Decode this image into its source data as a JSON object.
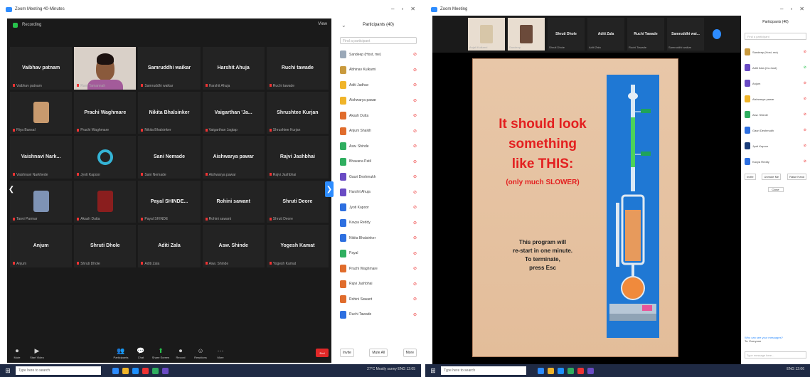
{
  "left": {
    "window_title": "Zoom Meeting 40-Minutes",
    "meeting_top": {
      "recording": "Recording",
      "view_label": "View"
    },
    "tiles": [
      {
        "name": "Vaibhav patnam",
        "sub": "Vaibhav patnam",
        "type": "name"
      },
      {
        "name": "",
        "sub": "Rani Tamannah",
        "type": "video"
      },
      {
        "name": "Samruddhi waikar",
        "sub": "Samruddhi waikar",
        "type": "name"
      },
      {
        "name": "Harshit Ahuja",
        "sub": "Harshit Ahuja",
        "type": "name"
      },
      {
        "name": "Ruchi tawade",
        "sub": "Ruchi tawade",
        "type": "name"
      },
      {
        "name": "",
        "sub": "Riya Bansal",
        "type": "photo",
        "color": "#c89a6e"
      },
      {
        "name": "Prachi Waghmare",
        "sub": "Prachi Waghmare",
        "type": "name"
      },
      {
        "name": "Nikita Bhalsinker",
        "sub": "Nikita Bhalsinker",
        "type": "name"
      },
      {
        "name": "Vaigarthan 'Ja...",
        "sub": "Vaigarthan Jagtap",
        "type": "name"
      },
      {
        "name": "Shrushtee Kurjan",
        "sub": "Shrushtee Kurjan",
        "type": "name"
      },
      {
        "name": "Vaishnavi Nark...",
        "sub": "Vaishnavi Narkhede",
        "type": "name"
      },
      {
        "name": "",
        "sub": "Jyoti Kapoor",
        "type": "ring"
      },
      {
        "name": "Sani Nemade",
        "sub": "Sani Nemade",
        "type": "name"
      },
      {
        "name": "Aishwarya pawar",
        "sub": "Aishwarya pawar",
        "type": "name"
      },
      {
        "name": "Rajvi Jashbhai",
        "sub": "Rajvi Jashbhai",
        "type": "name"
      },
      {
        "name": "",
        "sub": "Tanvi Parmar",
        "type": "photo",
        "color": "#7e93b5"
      },
      {
        "name": "",
        "sub": "Akash Dutta",
        "type": "photo",
        "color": "#8a1e1e"
      },
      {
        "name": "Payal SHINDE...",
        "sub": "Payal SHINDE",
        "type": "name"
      },
      {
        "name": "Rohini sawant",
        "sub": "Rohini sawant",
        "type": "name"
      },
      {
        "name": "Shruti Deore",
        "sub": "Shruti Deore",
        "type": "name"
      },
      {
        "name": "Anjum",
        "sub": "Anjum",
        "type": "name"
      },
      {
        "name": "Shruti Dhole",
        "sub": "Shruti Dhole",
        "type": "name"
      },
      {
        "name": "Aditi Zala",
        "sub": "Aditi Zala",
        "type": "name"
      },
      {
        "name": "Asw. Shinde",
        "sub": "Asw. Shinde",
        "type": "name"
      },
      {
        "name": "Yogesh Kamat",
        "sub": "Yogesh Kamat",
        "type": "name"
      }
    ],
    "toolbar": [
      {
        "icon": "⏺",
        "label": "Mute"
      },
      {
        "icon": "▶",
        "label": "Start Video"
      },
      {
        "icon": "👥",
        "label": "Participants"
      },
      {
        "icon": "💬",
        "label": "Chat"
      },
      {
        "icon": "⬆",
        "label": "Share Screen"
      },
      {
        "icon": "⏺",
        "label": "Record"
      },
      {
        "icon": "☺",
        "label": "Reactions"
      },
      {
        "icon": "⋯",
        "label": "More"
      }
    ],
    "end_label": "End",
    "participants": {
      "title": "Participants (40)",
      "search": "Find a participant",
      "rows": [
        {
          "name": "Sandeep (Host, me)",
          "color": "#9aa8b8"
        },
        {
          "name": "Abhinav Kulkarni",
          "color": "#c99a3e"
        },
        {
          "name": "Aditi Jadhav",
          "color": "#f0b429"
        },
        {
          "name": "Aishwarya pawar",
          "color": "#f0b429"
        },
        {
          "name": "Akash Dutta",
          "color": "#e06c2c"
        },
        {
          "name": "Anjum Shaikh",
          "color": "#e06c2c"
        },
        {
          "name": "Asw. Shinde",
          "color": "#2fae5f"
        },
        {
          "name": "Bhavana Patil",
          "color": "#2fae5f"
        },
        {
          "name": "Gauri Deshmukh",
          "color": "#6a4bc4"
        },
        {
          "name": "Harshit Ahuja",
          "color": "#6a4bc4"
        },
        {
          "name": "Jyoti Kapoor",
          "color": "#2d6fe0"
        },
        {
          "name": "Kavya Reddy",
          "color": "#2d6fe0"
        },
        {
          "name": "Nikita Bhalsinker",
          "color": "#2d6fe0"
        },
        {
          "name": "Payal",
          "color": "#2fae5f"
        },
        {
          "name": "Prachi Waghmare",
          "color": "#e06c2c"
        },
        {
          "name": "Rajvi Jashbhai",
          "color": "#e06c2c"
        },
        {
          "name": "Rohini Sawant",
          "color": "#e06c2c"
        },
        {
          "name": "Ruchi Tawade",
          "color": "#2d6fe0"
        }
      ],
      "foot": [
        "Invite",
        "Mute All",
        "More"
      ]
    },
    "taskbar": {
      "search": "Type here to search",
      "tray": "27°C  Mostly sunny   ENG  12:05"
    }
  },
  "right": {
    "window_title": "Zoom Meeting",
    "strip": [
      {
        "name": "",
        "sub": "Anjali Kulkarni",
        "type": "photo",
        "color": "#d7c6a8"
      },
      {
        "name": "",
        "sub": "Sandeep",
        "type": "photo",
        "color": "#6b4a3a"
      },
      {
        "name": "Shruti Dhole",
        "sub": "Shruti Dhole",
        "type": "name"
      },
      {
        "name": "Aditi Zala",
        "sub": "Aditi Zala",
        "type": "name"
      },
      {
        "name": "Ruchi Tawade",
        "sub": "Ruchi Tawade",
        "type": "name"
      },
      {
        "name": "Samruddhi wai...",
        "sub": "Samruddhi waikar",
        "type": "name"
      }
    ],
    "slide": {
      "line1": "It should look",
      "line2": "something",
      "line3": "like THIS:",
      "line4": "(only much SLOWER)",
      "note1": "This program will",
      "note2": "re-start in one minute.",
      "note3": "To terminate,",
      "note4": "press Esc"
    },
    "participants": {
      "title": "Participants (40)",
      "search": "Find a participant",
      "rows": [
        {
          "name": "Sandeep (Host, me)",
          "color": "#c99a3e"
        },
        {
          "name": "Aditi Zala (Co-host)",
          "color": "#6a4bc4"
        },
        {
          "name": "Anjum",
          "color": "#6a4bc4"
        },
        {
          "name": "Aishwarya pawar",
          "color": "#f0b429"
        },
        {
          "name": "Asw. Shinde",
          "color": "#2fae5f"
        },
        {
          "name": "Gauri Deshmukh",
          "color": "#2d6fe0"
        },
        {
          "name": "Jyoti Kapoor",
          "color": "#1d3f7a"
        },
        {
          "name": "Kavya Reddy",
          "color": "#2d6fe0"
        }
      ],
      "btns": [
        "Invite",
        "Unmute Me",
        "Raise Hand"
      ],
      "close": "Close",
      "chat": "Who can see your messages?",
      "chat_to": "To: Everyone",
      "chat_input": "Type message here..."
    },
    "taskbar": {
      "search": "Type here to search",
      "tray": "ENG  12:06"
    }
  }
}
